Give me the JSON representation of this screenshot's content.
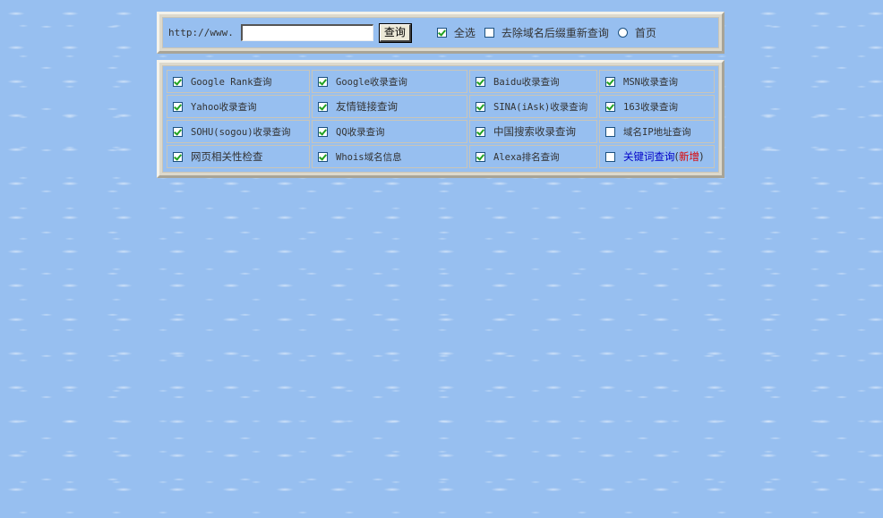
{
  "search": {
    "prefix": "http://www.",
    "input_value": "",
    "button_label": "查询",
    "select_all_label": "全选",
    "strip_suffix_label": "去除域名后缀重新查询",
    "home_label": "首页"
  },
  "options": [
    [
      {
        "label": "Google Rank查询",
        "checked": true
      },
      {
        "label": "Google收录查询",
        "checked": true
      },
      {
        "label": "Baidu收录查询",
        "checked": true
      },
      {
        "label": "MSN收录查询",
        "checked": true
      }
    ],
    [
      {
        "label": "Yahoo收录查询",
        "checked": true
      },
      {
        "label": "友情链接查询",
        "checked": true
      },
      {
        "label": "SINA(iAsk)收录查询",
        "checked": true
      },
      {
        "label": "163收录查询",
        "checked": true
      }
    ],
    [
      {
        "label": "SOHU(sogou)收录查询",
        "checked": true
      },
      {
        "label": "QQ收录查询",
        "checked": true
      },
      {
        "label": "中国搜索收录查询",
        "checked": true
      },
      {
        "label": "域名IP地址查询",
        "checked": false
      }
    ],
    [
      {
        "label": "网页相关性检查",
        "checked": true
      },
      {
        "label": "Whois域名信息",
        "checked": true
      },
      {
        "label": "Alexa排名查询",
        "checked": true
      },
      {
        "label": "关键词查询",
        "checked": false,
        "link": true,
        "extra_open": "(",
        "extra": "新增",
        "extra_close": ")"
      }
    ]
  ],
  "colors": {
    "background": "#97bff0",
    "frame": "#ddd9cc",
    "check": "#21a121",
    "link": "#0000c8",
    "new_badge": "#dd0000"
  }
}
